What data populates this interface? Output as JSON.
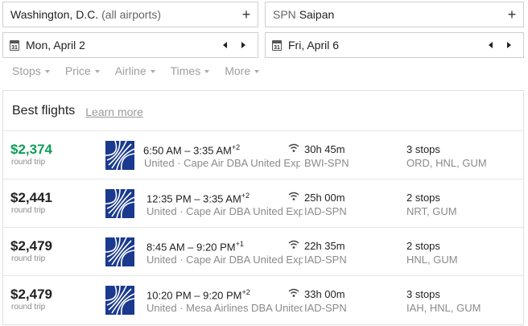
{
  "search": {
    "origin": "Washington, D.C.",
    "origin_suffix": "(all airports)",
    "destination_code": "SPN",
    "destination_name": "Saipan",
    "depart_date": "Mon, April 2",
    "return_date": "Fri, April 6",
    "add_symbol": "+",
    "calendar_day": "31"
  },
  "filters": [
    "Stops",
    "Price",
    "Airline",
    "Times",
    "More"
  ],
  "results": {
    "title": "Best flights",
    "learn_more": "Learn more",
    "flights": [
      {
        "price": "$2,374",
        "price_note": "round trip",
        "time": "6:50 AM – 3:35 AM",
        "day_offset": "+2",
        "airline": "United · Cape Air DBA United Express",
        "duration": "30h 45m",
        "route": "BWI-SPN",
        "stops": "3 stops",
        "layovers": "ORD, HNL, GUM",
        "best": true
      },
      {
        "price": "$2,441",
        "price_note": "round trip",
        "time": "12:35 PM – 3:35 AM",
        "day_offset": "+2",
        "airline": "United · Cape Air DBA United Express",
        "duration": "25h 00m",
        "route": "IAD-SPN",
        "stops": "2 stops",
        "layovers": "NRT, GUM",
        "best": false
      },
      {
        "price": "$2,479",
        "price_note": "round trip",
        "time": "8:45 AM – 9:20 PM",
        "day_offset": "+1",
        "airline": "United · Cape Air DBA United Express",
        "duration": "22h 35m",
        "route": "IAD-SPN",
        "stops": "2 stops",
        "layovers": "HNL, GUM",
        "best": false
      },
      {
        "price": "$2,479",
        "price_note": "round trip",
        "time": "10:20 PM – 9:20 PM",
        "day_offset": "+2",
        "airline": "United · Mesa Airlines DBA United Express",
        "duration": "33h 00m",
        "route": "IAD-SPN",
        "stops": "3 stops",
        "layovers": "IAH, HNL, GUM",
        "best": false
      }
    ]
  },
  "colors": {
    "best_price": "#0f9d58",
    "united_blue": "#1a3a8f"
  },
  "icons": {
    "calendar": "calendar-icon",
    "wifi": "wifi-icon",
    "prev": "arrow-left-icon",
    "next": "arrow-right-icon"
  }
}
